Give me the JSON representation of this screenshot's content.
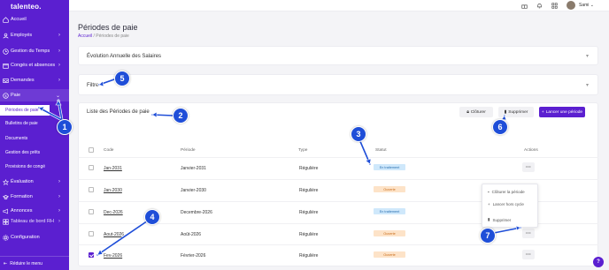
{
  "app": {
    "logo": "talenteo."
  },
  "sidebar": {
    "items": [
      {
        "label": "Accueil",
        "icon": "home-icon",
        "chevron": ""
      },
      {
        "label": "Employés",
        "icon": "users-icon",
        "chevron": "›"
      },
      {
        "label": "Gestion du Temps",
        "icon": "clock-icon",
        "chevron": "›"
      },
      {
        "label": "Congés et absences",
        "icon": "calendar-icon",
        "chevron": "›"
      },
      {
        "label": "Demandes",
        "icon": "inbox-icon",
        "chevron": "›"
      },
      {
        "label": "Paie",
        "icon": "money-icon",
        "chevron": "⌄"
      }
    ],
    "sub_items": [
      {
        "label": "Périodes de paie"
      },
      {
        "label": "Bulletins de paie"
      },
      {
        "label": "Documents"
      },
      {
        "label": "Gestion des prêts"
      },
      {
        "label": "Provisions de congé"
      }
    ],
    "items_after": [
      {
        "label": "Évaluation",
        "icon": "star-icon",
        "chevron": "›"
      },
      {
        "label": "Formation",
        "icon": "graduation-icon",
        "chevron": "›"
      },
      {
        "label": "Annonces",
        "icon": "megaphone-icon",
        "chevron": "›"
      },
      {
        "label": "Tableau de bord RH",
        "icon": "dashboard-icon",
        "chevron": "›"
      },
      {
        "label": "Configuration",
        "icon": "gear-icon",
        "chevron": ""
      }
    ],
    "footer": "Réduire le menu"
  },
  "topbar": {
    "username": "Sami",
    "username_chevron": "⌄"
  },
  "page": {
    "title": "Périodes de paie",
    "breadcrumb": {
      "home": "Accueil",
      "separator": "/",
      "current": "Périodes de paie"
    }
  },
  "cards": {
    "evolution": "Évolution Annuelle des Salaires",
    "filter": "Filtre",
    "list_title": "Liste des Périodes de paie"
  },
  "toolbar": {
    "close_label": "Clôturer",
    "delete_label": "Supprimer",
    "launch_label": "Lancer une période"
  },
  "table": {
    "headers": {
      "code": "Code",
      "period": "Période",
      "type": "Type",
      "status": "Statut",
      "actions": "Actions"
    },
    "rows": [
      {
        "code": "Jan-2031",
        "period": "Janvier-2031",
        "type": "Régulière",
        "status": "En traitement",
        "status_kind": "processing",
        "checked": false
      },
      {
        "code": "Jan-2030",
        "period": "Janvier-2030",
        "type": "Régulière",
        "status": "Ouverte",
        "status_kind": "open",
        "checked": false
      },
      {
        "code": "Dec-2026",
        "period": "Decembre-2026",
        "type": "Régulière",
        "status": "En traitement",
        "status_kind": "processing",
        "checked": false
      },
      {
        "code": "Aout-2026",
        "period": "Août-2026",
        "type": "Régulière",
        "status": "Ouverte",
        "status_kind": "open",
        "checked": false
      },
      {
        "code": "Fev-2026",
        "period": "Février-2026",
        "type": "Régulière",
        "status": "Ouverte",
        "status_kind": "open",
        "checked": true
      }
    ],
    "action_label": "···"
  },
  "dropdown": {
    "items": [
      {
        "label": "Clôturer la période",
        "icon": "lock-icon"
      },
      {
        "label": "Lancer hors cycle",
        "icon": "plus-icon"
      },
      {
        "label": "Supprimer",
        "icon": "trash-icon"
      }
    ]
  },
  "annotations": [
    "1",
    "2",
    "3",
    "4",
    "5",
    "6",
    "7"
  ],
  "help_label": "?",
  "colors": {
    "brand": "#5b1fd0",
    "processing_bg": "#cfe8fb",
    "open_bg": "#fde3c8",
    "marker": "#1f4ed8"
  }
}
